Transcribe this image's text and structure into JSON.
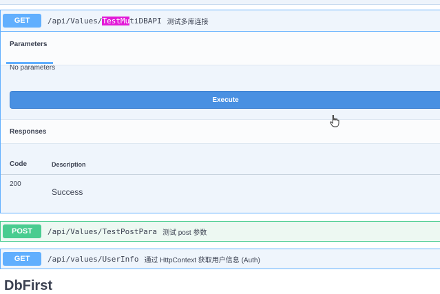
{
  "operations": [
    {
      "method": "GET",
      "path_prefix": "/api/Values/",
      "path_highlight": "TestMu",
      "path_suffix": "tiDBAPI",
      "description": "测试多库连接",
      "tab": "Parameters",
      "no_params": "No parameters",
      "execute_label": "Execute",
      "responses_title": "Responses",
      "col_code": "Code",
      "col_description": "Description",
      "responses": [
        {
          "code": "200",
          "description": "Success"
        }
      ]
    },
    {
      "method": "POST",
      "path": "/api/Values/TestPostPara",
      "description": "测试 post 参数"
    },
    {
      "method": "GET",
      "path": "/api/values/UserInfo",
      "description": "通过 HttpContext 获取用户信息 (Auth)"
    }
  ],
  "next_section": "DbFirst",
  "colors": {
    "get": "#61affe",
    "post": "#49cc90",
    "execute": "#4990e2",
    "search_highlight": "#e21bd8"
  },
  "icons": [
    "hand-pointer-cursor-icon"
  ]
}
